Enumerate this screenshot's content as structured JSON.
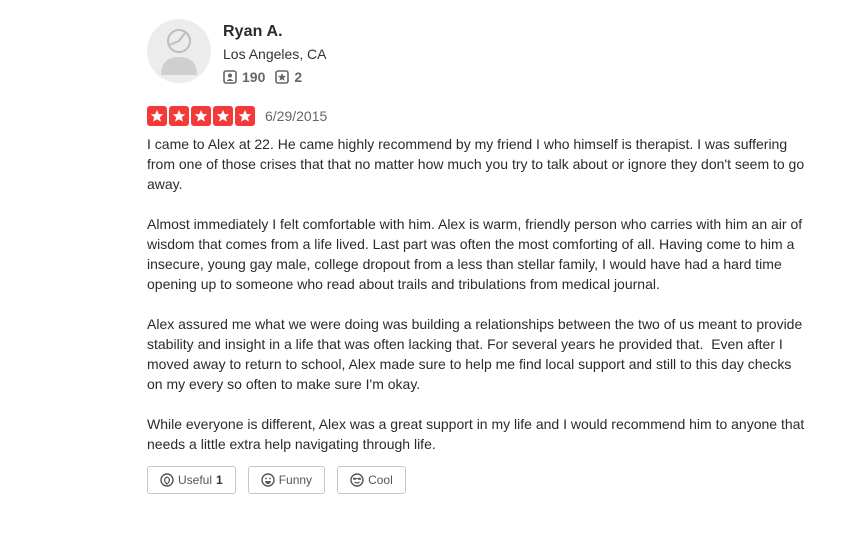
{
  "user": {
    "name": "Ryan A.",
    "location": "Los Angeles, CA",
    "friends_count": "190",
    "reviews_count": "2",
    "friends_icon": "friends-icon",
    "reviews_icon": "review-star-icon"
  },
  "review": {
    "rating": 5,
    "max_rating": 5,
    "star_color": "#f43939",
    "date": "6/29/2015",
    "paragraphs": [
      "I came to Alex at 22. He came highly recommend by my friend I who himself is therapist. I was suffering from one of those crises that that no matter how much you try to talk about or ignore they don't seem to go away.",
      "Almost immediately I felt comfortable with him. Alex is warm, friendly person who carries with him an air of wisdom that comes from a life lived. Last part was often the most comforting of all. Having come to him a insecure, young gay male, college dropout from a less than stellar family, I would have had a hard time opening up to someone who read about trails and tribulations from medical journal.",
      "Alex assured me what we were doing was building a relationships between the two of us meant to provide stability and insight in a life that was often lacking that. For several years he provided that.  Even after I moved away to return to school, Alex made sure to help me find local support and still to this day checks on my every so often to make sure I'm okay.",
      "While everyone is different, Alex was a great support in my life and I would recommend him to anyone that needs a little extra help navigating through life."
    ]
  },
  "actions": {
    "useful_label": "Useful",
    "useful_count": "1",
    "funny_label": "Funny",
    "cool_label": "Cool"
  }
}
